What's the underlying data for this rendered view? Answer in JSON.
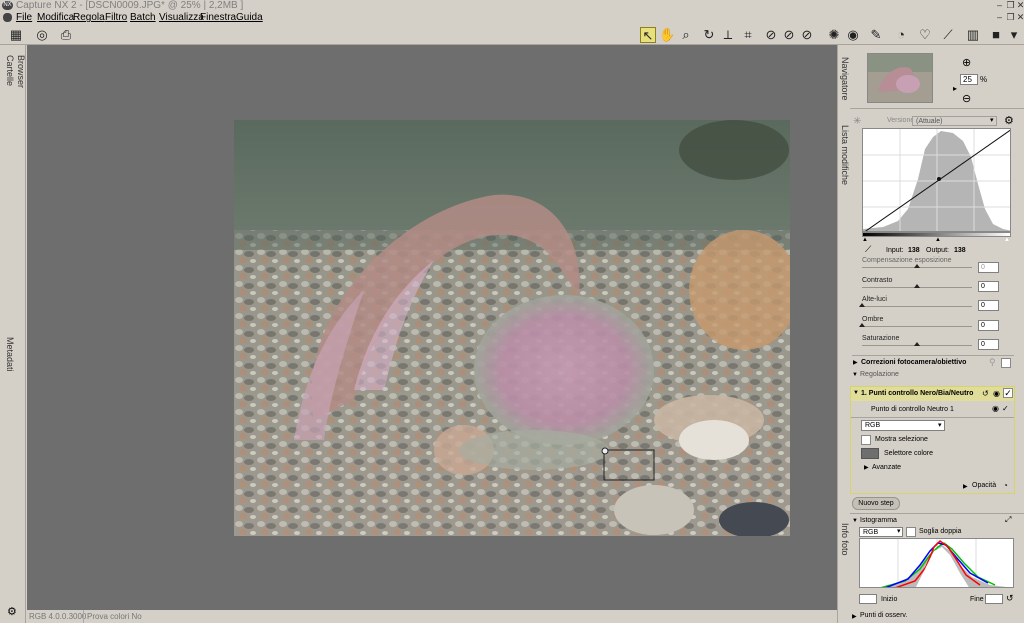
{
  "window": {
    "title": "Capture NX 2 - [DSCN0009.JPG* @ 25% | 2,2MB ]",
    "app_icon": "NX"
  },
  "menu": [
    "File",
    "Modifica",
    "Regola",
    "Filtro",
    "Batch",
    "Visualizza",
    "Finestra",
    "Guida"
  ],
  "left_tabs": {
    "cartelle": "Cartelle",
    "browser": "Browser",
    "metadati": "Metadati"
  },
  "status": {
    "color_profile": "RGB 4.0.0.3000",
    "proof": "Prova colori No"
  },
  "navigator": {
    "tab": "Navigatore",
    "zoom": "25",
    "percent": "%"
  },
  "edit_list": {
    "tab": "Lista modifiche",
    "version_label": "Versione",
    "version_value": "(Attuale)",
    "input_label": "Input:",
    "input_value": "138",
    "output_label": "Output:",
    "output_value": "138",
    "sliders": [
      {
        "label": "Compensazione esposizione",
        "value": "0",
        "level": 0.5
      },
      {
        "label": "Contrasto",
        "value": "0",
        "level": 0.5
      },
      {
        "label": "Alte-luci",
        "value": "0",
        "level": 0.0
      },
      {
        "label": "Ombre",
        "value": "0",
        "level": 0.0
      },
      {
        "label": "Saturazione",
        "value": "0",
        "level": 0.5
      }
    ],
    "camera_corrections": "Correzioni fotocamera/obiettivo",
    "section_adjust": "Regolazione",
    "step_title": "1. Punti controllo Nero/Bia/Neutro",
    "control_point": "Punto di controllo Neutro 1",
    "channel": "RGB",
    "show_selection": "Mostra selezione",
    "color_picker": "Selettore colore",
    "advanced": "Avanzate",
    "opacity": "Opacità",
    "new_step": "Nuovo step"
  },
  "photo_info": {
    "tab": "Info foto",
    "title": "Istogramma",
    "channel": "RGB",
    "double_threshold": "Soglia doppia",
    "start_label": "Inizio",
    "end_label": "Fine",
    "points": "Punti di osserv."
  }
}
